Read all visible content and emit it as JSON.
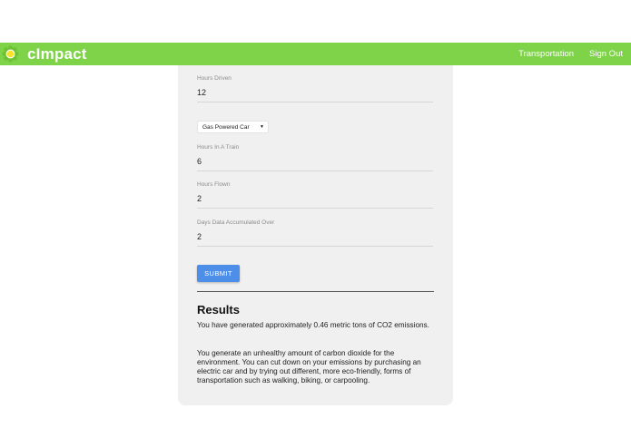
{
  "app": {
    "brand": "cImpact",
    "nav": [
      "Transportation",
      "Sign Out"
    ],
    "colors": {
      "navbar": "#7ed348",
      "logo_green": "#6ec231",
      "logo_yellow": "#f7e22a",
      "button": "#4c8ee8"
    },
    "logo_icon": "sunflower-icon"
  },
  "form": {
    "hours_driven": {
      "label": "Hours Driven",
      "value": "12"
    },
    "vehicle_select": {
      "value": "Gas Powered Car",
      "icon": "dropdown-caret-icon"
    },
    "hours_train": {
      "label": "Hours In A Train",
      "value": "6"
    },
    "hours_flown": {
      "label": "Hours Flown",
      "value": "2"
    },
    "days_accumulated": {
      "label": "Days Data Accumulated Over",
      "value": "2"
    },
    "submit_label": "SUBMIT"
  },
  "results": {
    "title": "Results",
    "summary": "You have generated approximately 0.46 metric tons of CO2 emissions.",
    "advice": "You generate an unhealthy amount of carbon dioxide for the environment. You can cut down on your emissions by purchasing an electric car and by trying out different, more eco-friendly, forms of transportation such as walking, biking, or carpooling."
  }
}
